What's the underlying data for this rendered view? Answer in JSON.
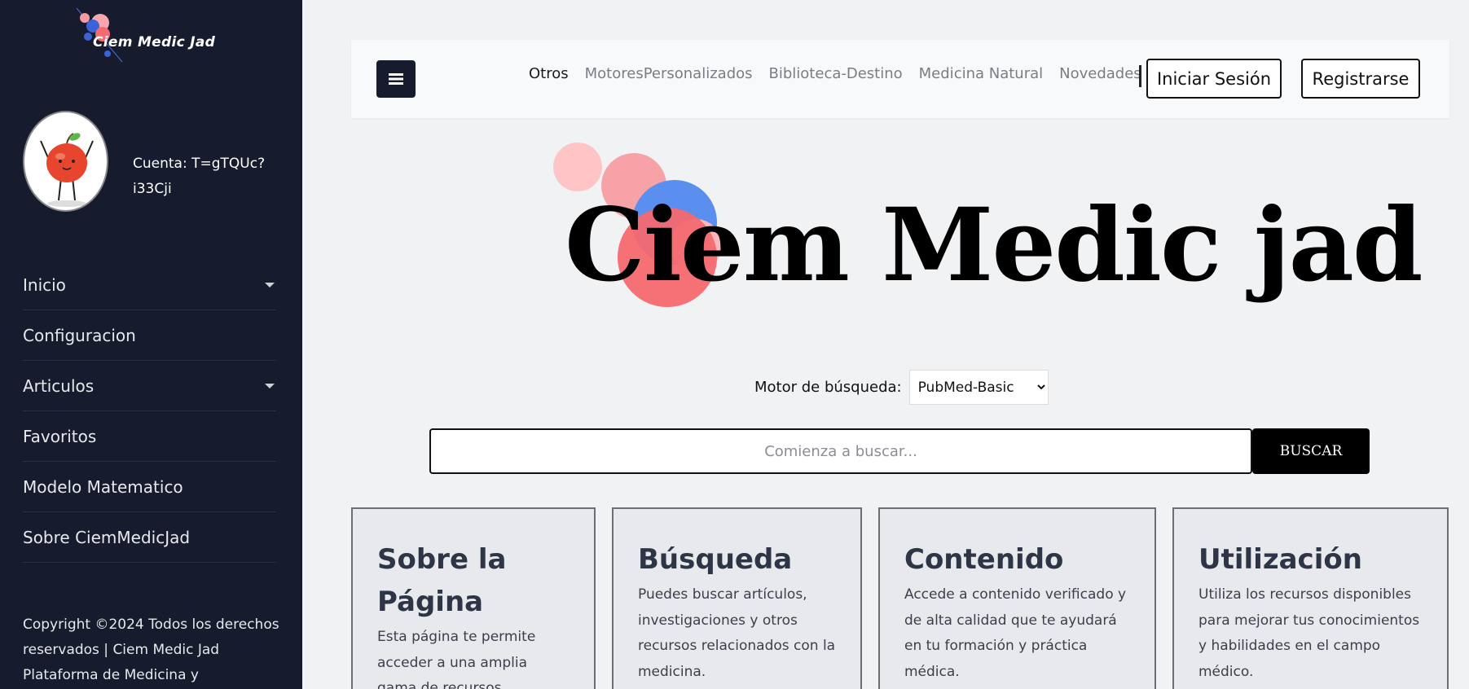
{
  "sidebar": {
    "logo_text": "Ciem Medic Jad",
    "account": "Cuenta: T=gTQUc?i33Cji",
    "nav": [
      {
        "label": "Inicio",
        "has_dropdown": true
      },
      {
        "label": "Configuracion",
        "has_dropdown": false
      },
      {
        "label": "Articulos",
        "has_dropdown": true
      },
      {
        "label": "Favoritos",
        "has_dropdown": false
      },
      {
        "label": "Modelo Matematico",
        "has_dropdown": false
      },
      {
        "label": "Sobre CiemMedicJad",
        "has_dropdown": false
      }
    ],
    "copyright": "Copyright ©2024 Todos los derechos reservados | Ciem Medic Jad Plataforma de Medicina y"
  },
  "header": {
    "menu_icon": "hamburger-icon",
    "links": [
      "Otros",
      "MotoresPersonalizados",
      "Biblioteca-Destino",
      "Medicina Natural",
      "Novedades"
    ],
    "login_label": "Iniciar Sesión",
    "register_label": "Registrarse"
  },
  "hero": {
    "title": "Ciem Medic jad"
  },
  "search": {
    "engine_label": "Motor de búsqueda:",
    "engine_selected": "PubMed-Basic",
    "placeholder": "Comienza a buscar...",
    "button_label": "BUSCAR"
  },
  "cards": [
    {
      "title": "Sobre la Página",
      "text": "Esta página te permite acceder a una amplia gama de recursos"
    },
    {
      "title": "Búsqueda",
      "text": "Puedes buscar artículos, investigaciones y otros recursos relacionados con la medicina."
    },
    {
      "title": "Contenido",
      "text": "Accede a contenido verificado y de alta calidad que te ayudará en tu formación y práctica médica."
    },
    {
      "title": "Utilización",
      "text": "Utiliza los recursos disponibles para mejorar tus conocimientos y habilidades en el campo médico."
    }
  ],
  "colors": {
    "sidebar_bg": "#161b2e",
    "page_bg": "#f1f2f4",
    "card_title": "#2d3546"
  }
}
